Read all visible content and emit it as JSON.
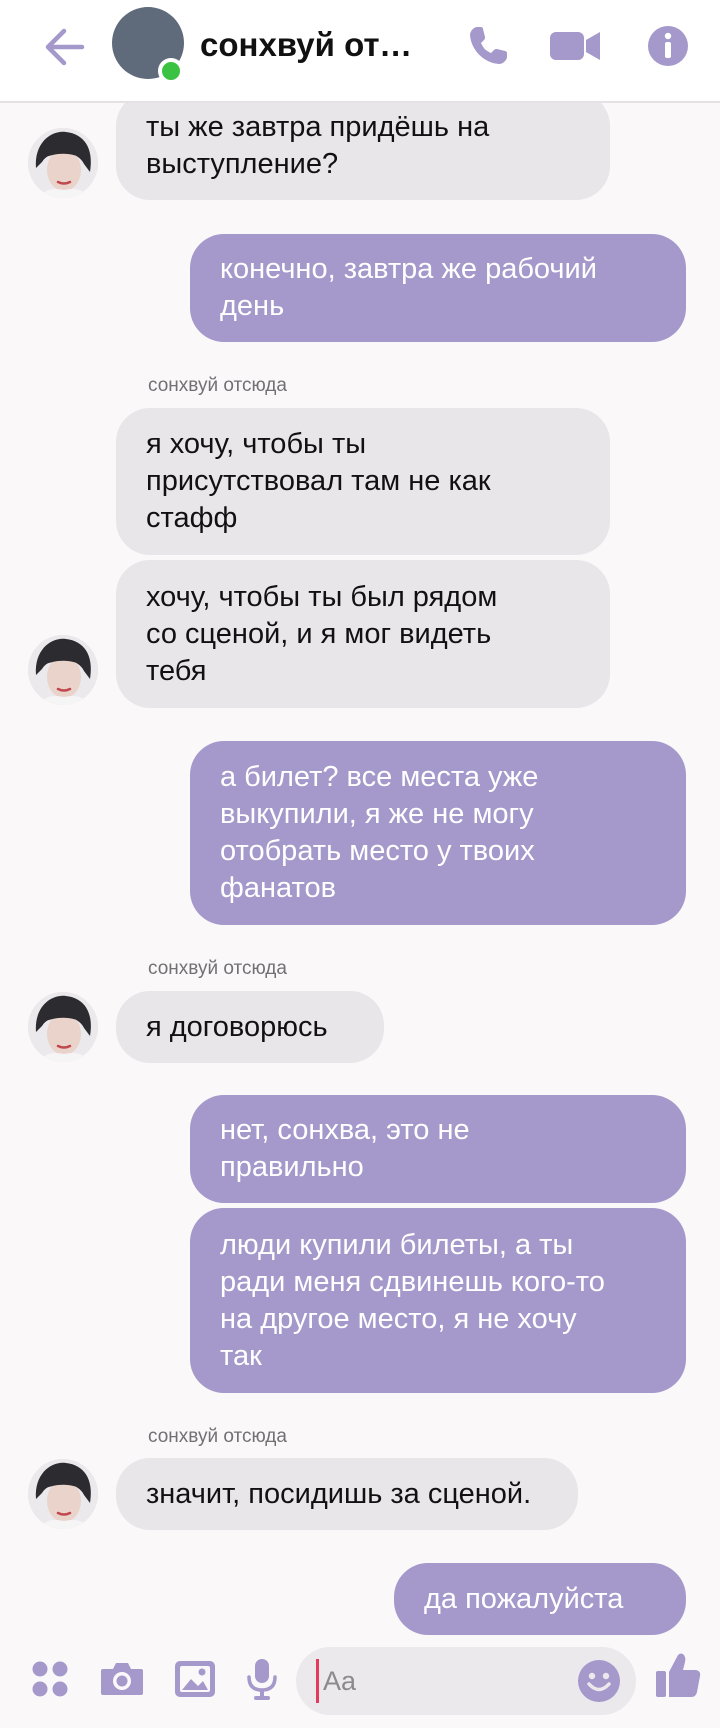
{
  "header": {
    "title": "сонхвуй отс...",
    "icons": [
      "back-arrow-icon",
      "phone-icon",
      "video-camera-icon",
      "info-icon"
    ],
    "online": true
  },
  "messages": [
    {
      "type": "in",
      "text": "ты же завтра придёшь на\nвыступление?"
    },
    {
      "type": "out",
      "text": "конечно, завтра же рабочий\nдень"
    },
    {
      "type": "sender",
      "text": "сонхвуй отсюда"
    },
    {
      "type": "in",
      "text": "я хочу, чтобы ты\nприсутствовал там не как\nстафф"
    },
    {
      "type": "in",
      "text": "хочу, чтобы ты был рядом\nсо сценой, и я мог видеть\nтебя"
    },
    {
      "type": "out",
      "text": "а билет? все места уже\nвыкупили, я же не могу\nотобрать место у твоих\nфанатов"
    },
    {
      "type": "sender",
      "text": "сонхвуй отсюда"
    },
    {
      "type": "in",
      "text": "я договорюсь"
    },
    {
      "type": "out",
      "text": "нет, сонхва, это не\nправильно"
    },
    {
      "type": "out",
      "text": "люди купили билеты, а ты\nради меня сдвинешь кого-то\nна другое место, я не хочу\nтак"
    },
    {
      "type": "sender",
      "text": "сонхвуй отсюда"
    },
    {
      "type": "in",
      "text": "значит, посидишь за сценой."
    },
    {
      "type": "out",
      "text": "да пожалуйста"
    }
  ],
  "composer": {
    "placeholder": "Aa",
    "icons": [
      "apps-grid-icon",
      "camera-icon",
      "gallery-icon",
      "microphone-icon",
      "emoji-icon",
      "thumbs-up-icon"
    ]
  },
  "colors": {
    "accent": "#a598cb",
    "incoming_bubble": "#e9e6ea",
    "online": "#3cc243",
    "background": "#fbf8fa"
  }
}
